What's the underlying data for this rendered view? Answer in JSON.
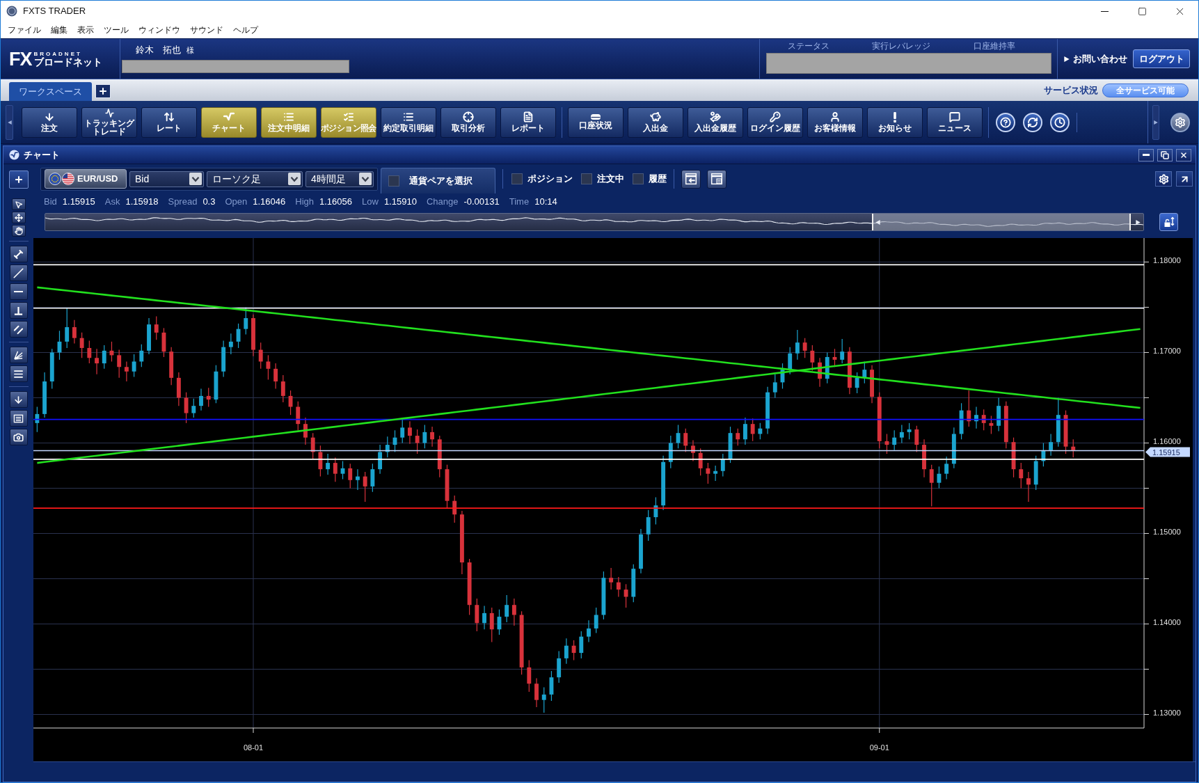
{
  "window": {
    "title": "FXTS TRADER"
  },
  "menu": [
    "ファイル",
    "編集",
    "表示",
    "ツール",
    "ウィンドウ",
    "サウンド",
    "ヘルプ"
  ],
  "header": {
    "logo": {
      "mark": "FX",
      "tagline": "BROADNET",
      "name": "ブロードネット"
    },
    "user": {
      "name": "鈴木　拓也",
      "honorific": "様"
    },
    "account_labels": [
      "ステータス",
      "実行レバレッジ",
      "口座維持率"
    ],
    "inquiry": "お問い合わせ",
    "logout": "ログアウト"
  },
  "tabs": [
    {
      "label": "ワークスペース",
      "selected": true
    }
  ],
  "service": {
    "label": "サービス状況",
    "status": "全サービス可能"
  },
  "toolbar": {
    "groups": [
      [
        {
          "label": "注文",
          "active": false
        },
        {
          "label": "トラッキングトレード",
          "active": false
        },
        {
          "label": "レート",
          "active": false
        },
        {
          "label": "チャート",
          "active": true
        },
        {
          "label": "注文中明細",
          "active": true
        },
        {
          "label": "ポジション照会",
          "active": true
        },
        {
          "label": "約定取引明細",
          "active": false
        },
        {
          "label": "取引分析",
          "active": false
        },
        {
          "label": "レポート",
          "active": false
        }
      ],
      [
        {
          "label": "口座状況",
          "active": false
        },
        {
          "label": "入出金",
          "active": false
        },
        {
          "label": "入出金履歴",
          "active": false
        },
        {
          "label": "ログイン履歴",
          "active": false
        },
        {
          "label": "お客様情報",
          "active": false
        },
        {
          "label": "お知らせ",
          "active": false
        },
        {
          "label": "ニュース",
          "active": false
        }
      ]
    ]
  },
  "chart_window": {
    "title": "チャート",
    "pair": "EUR/USD",
    "selects": [
      {
        "value": "Bid"
      },
      {
        "value": "ローソク足"
      },
      {
        "value": "4時間足"
      }
    ],
    "pair_picker": {
      "label": "通貨ペアを選択",
      "checked": false
    },
    "filters": [
      {
        "label": "ポジション",
        "checked": false
      },
      {
        "label": "注文中",
        "checked": false
      },
      {
        "label": "履歴",
        "checked": false
      }
    ],
    "quote": [
      {
        "label": "Bid",
        "value": "1.15915"
      },
      {
        "label": "Ask",
        "value": "1.15918"
      },
      {
        "label": "Spread",
        "value": "0.3"
      },
      {
        "label": "Open",
        "value": "1.16046"
      },
      {
        "label": "High",
        "value": "1.16056"
      },
      {
        "label": "Low",
        "value": "1.15910"
      },
      {
        "label": "Change",
        "value": "-0.00131"
      },
      {
        "label": "Time",
        "value": "10:14"
      }
    ],
    "chart_data": {
      "type": "candlestick",
      "grid": true,
      "ylim": [
        1.1285,
        1.18265
      ],
      "yticks": [
        {
          "value": 1.13,
          "label": "1.13000"
        },
        {
          "value": 1.14,
          "label": "1.14000"
        },
        {
          "value": 1.15,
          "label": "1.15000"
        },
        {
          "value": 1.16,
          "label": "1.16000"
        },
        {
          "value": 1.17,
          "label": "1.17000"
        },
        {
          "value": 1.18,
          "label": "1.18000"
        }
      ],
      "categories": [
        null,
        null,
        null,
        null,
        null,
        null,
        null,
        null,
        null,
        null,
        null,
        null,
        null,
        null,
        null,
        null,
        null,
        null,
        null,
        null,
        null,
        null,
        null,
        null,
        null,
        null,
        null,
        null,
        null,
        "08-01",
        null,
        null,
        null,
        null,
        null,
        null,
        null,
        null,
        null,
        null,
        null,
        null,
        null,
        null,
        null,
        null,
        null,
        null,
        null,
        null,
        null,
        null,
        null,
        null,
        null,
        null,
        null,
        null,
        null,
        null,
        null,
        null,
        null,
        null,
        null,
        null,
        null,
        null,
        null,
        null,
        null,
        null,
        null,
        null,
        null,
        null,
        null,
        null,
        null,
        null,
        null,
        null,
        null,
        null,
        null,
        null,
        null,
        null,
        null,
        null,
        null,
        null,
        null,
        null,
        null,
        null,
        null,
        null,
        null,
        null,
        null,
        null,
        null,
        null,
        null,
        null,
        null,
        null,
        null,
        null,
        null,
        null,
        null,
        "09-01",
        null,
        null,
        null,
        null,
        null,
        null,
        null,
        null,
        null,
        null,
        null,
        null,
        null,
        null,
        null,
        null,
        null,
        null,
        null,
        null,
        null,
        null,
        null,
        null,
        null,
        null,
        null,
        null,
        null,
        null,
        null,
        null,
        null,
        null,
        null
      ],
      "ohlc": [
        [
          1.1622,
          1.164,
          1.1612,
          1.1632
        ],
        [
          1.1632,
          1.1678,
          1.1628,
          1.1668
        ],
        [
          1.1668,
          1.1704,
          1.166,
          1.17
        ],
        [
          1.17,
          1.1724,
          1.1692,
          1.1712
        ],
        [
          1.1712,
          1.1749,
          1.1705,
          1.1728
        ],
        [
          1.1728,
          1.1736,
          1.171,
          1.1716
        ],
        [
          1.1716,
          1.1722,
          1.1694,
          1.1705
        ],
        [
          1.1705,
          1.1713,
          1.1688,
          1.1694
        ],
        [
          1.1694,
          1.1704,
          1.1676,
          1.1688
        ],
        [
          1.1688,
          1.1708,
          1.1682,
          1.1702
        ],
        [
          1.1702,
          1.1712,
          1.169,
          1.1697
        ],
        [
          1.1697,
          1.1703,
          1.1672,
          1.1684
        ],
        [
          1.1684,
          1.169,
          1.1668,
          1.1679
        ],
        [
          1.1679,
          1.1698,
          1.1673,
          1.169
        ],
        [
          1.169,
          1.1709,
          1.1684,
          1.1702
        ],
        [
          1.1702,
          1.1738,
          1.1698,
          1.1731
        ],
        [
          1.1731,
          1.174,
          1.1714,
          1.1722
        ],
        [
          1.1722,
          1.1727,
          1.1695,
          1.1701
        ],
        [
          1.1701,
          1.1706,
          1.1664,
          1.1672
        ],
        [
          1.1672,
          1.1678,
          1.1641,
          1.165
        ],
        [
          1.165,
          1.1656,
          1.1622,
          1.1633
        ],
        [
          1.1633,
          1.1649,
          1.1628,
          1.1641
        ],
        [
          1.1641,
          1.166,
          1.1636,
          1.1652
        ],
        [
          1.1652,
          1.1661,
          1.164,
          1.1648
        ],
        [
          1.1648,
          1.1686,
          1.1644,
          1.1679
        ],
        [
          1.1679,
          1.1713,
          1.1673,
          1.1706
        ],
        [
          1.1706,
          1.1721,
          1.1698,
          1.1712
        ],
        [
          1.1712,
          1.1732,
          1.1705,
          1.1726
        ],
        [
          1.1726,
          1.175,
          1.172,
          1.1738
        ],
        [
          1.1738,
          1.1742,
          1.1696,
          1.1703
        ],
        [
          1.1703,
          1.1711,
          1.1682,
          1.169
        ],
        [
          1.169,
          1.1697,
          1.167,
          1.1682
        ],
        [
          1.1682,
          1.1688,
          1.166,
          1.1668
        ],
        [
          1.1668,
          1.1675,
          1.1645,
          1.1652
        ],
        [
          1.1652,
          1.1658,
          1.1631,
          1.164
        ],
        [
          1.164,
          1.1646,
          1.1614,
          1.1621
        ],
        [
          1.1621,
          1.1628,
          1.1598,
          1.1606
        ],
        [
          1.1606,
          1.1611,
          1.1582,
          1.159
        ],
        [
          1.159,
          1.1597,
          1.1563,
          1.1571
        ],
        [
          1.1571,
          1.1588,
          1.1565,
          1.1578
        ],
        [
          1.1578,
          1.1584,
          1.1557,
          1.1566
        ],
        [
          1.1566,
          1.158,
          1.156,
          1.1572
        ],
        [
          1.1572,
          1.1577,
          1.155,
          1.1559
        ],
        [
          1.1559,
          1.1571,
          1.1548,
          1.1563
        ],
        [
          1.1563,
          1.1568,
          1.1535,
          1.1552
        ],
        [
          1.1552,
          1.1577,
          1.1546,
          1.1571
        ],
        [
          1.1571,
          1.1598,
          1.1566,
          1.159
        ],
        [
          1.159,
          1.1607,
          1.1584,
          1.1598
        ],
        [
          1.1598,
          1.1614,
          1.159,
          1.1606
        ],
        [
          1.1606,
          1.1626,
          1.16,
          1.1617
        ],
        [
          1.1617,
          1.1624,
          1.1599,
          1.1608
        ],
        [
          1.1608,
          1.1615,
          1.1588,
          1.16
        ],
        [
          1.16,
          1.162,
          1.1594,
          1.1612
        ],
        [
          1.1612,
          1.1618,
          1.1596,
          1.1604
        ],
        [
          1.1604,
          1.1608,
          1.1562,
          1.1571
        ],
        [
          1.1571,
          1.1576,
          1.1528,
          1.1536
        ],
        [
          1.1536,
          1.1542,
          1.1512,
          1.1521
        ],
        [
          1.1521,
          1.1525,
          1.1455,
          1.1468
        ],
        [
          1.1468,
          1.1472,
          1.141,
          1.1421
        ],
        [
          1.1421,
          1.1428,
          1.1392,
          1.1401
        ],
        [
          1.1401,
          1.142,
          1.1394,
          1.1412
        ],
        [
          1.1412,
          1.1418,
          1.138,
          1.1394
        ],
        [
          1.1394,
          1.1416,
          1.1388,
          1.1408
        ],
        [
          1.1408,
          1.1432,
          1.1402,
          1.1421
        ],
        [
          1.1421,
          1.1428,
          1.1398,
          1.141
        ],
        [
          1.141,
          1.1414,
          1.1344,
          1.1352
        ],
        [
          1.1352,
          1.136,
          1.1325,
          1.1334
        ],
        [
          1.1334,
          1.134,
          1.1308,
          1.1316
        ],
        [
          1.1316,
          1.133,
          1.1302,
          1.1322
        ],
        [
          1.1322,
          1.1348,
          1.1315,
          1.1341
        ],
        [
          1.1341,
          1.137,
          1.1335,
          1.1362
        ],
        [
          1.1362,
          1.1384,
          1.1356,
          1.1376
        ],
        [
          1.1376,
          1.1382,
          1.136,
          1.1368
        ],
        [
          1.1368,
          1.1392,
          1.1362,
          1.1386
        ],
        [
          1.1386,
          1.1404,
          1.138,
          1.1395
        ],
        [
          1.1395,
          1.1418,
          1.139,
          1.141
        ],
        [
          1.141,
          1.1458,
          1.1405,
          1.1451
        ],
        [
          1.1451,
          1.1462,
          1.1438,
          1.1446
        ],
        [
          1.1446,
          1.1452,
          1.143,
          1.1438
        ],
        [
          1.1438,
          1.1444,
          1.1418,
          1.143
        ],
        [
          1.143,
          1.1466,
          1.1424,
          1.1461
        ],
        [
          1.1461,
          1.1505,
          1.1456,
          1.1499
        ],
        [
          1.1499,
          1.1526,
          1.1492,
          1.1518
        ],
        [
          1.1518,
          1.154,
          1.151,
          1.1531
        ],
        [
          1.1531,
          1.1586,
          1.1526,
          1.1579
        ],
        [
          1.1579,
          1.1608,
          1.1572,
          1.16
        ],
        [
          1.16,
          1.162,
          1.1594,
          1.1611
        ],
        [
          1.1611,
          1.1616,
          1.159,
          1.1597
        ],
        [
          1.1597,
          1.1603,
          1.158,
          1.1589
        ],
        [
          1.1589,
          1.1594,
          1.1564,
          1.1572
        ],
        [
          1.1572,
          1.1578,
          1.1555,
          1.1566
        ],
        [
          1.1566,
          1.1575,
          1.1558,
          1.1569
        ],
        [
          1.1569,
          1.1588,
          1.1563,
          1.1582
        ],
        [
          1.1582,
          1.1618,
          1.1578,
          1.1611
        ],
        [
          1.1611,
          1.1616,
          1.1597,
          1.1604
        ],
        [
          1.1604,
          1.1628,
          1.1598,
          1.1621
        ],
        [
          1.1621,
          1.1627,
          1.1602,
          1.161
        ],
        [
          1.161,
          1.1622,
          1.1604,
          1.1616
        ],
        [
          1.1616,
          1.1662,
          1.161,
          1.1656
        ],
        [
          1.1656,
          1.1676,
          1.165,
          1.1667
        ],
        [
          1.1667,
          1.1688,
          1.166,
          1.1681
        ],
        [
          1.1681,
          1.1706,
          1.1676,
          1.1699
        ],
        [
          1.1699,
          1.1725,
          1.1692,
          1.1711
        ],
        [
          1.1711,
          1.1716,
          1.1694,
          1.1702
        ],
        [
          1.1702,
          1.1708,
          1.168,
          1.1689
        ],
        [
          1.1689,
          1.1694,
          1.1662,
          1.1671
        ],
        [
          1.1671,
          1.17,
          1.1666,
          1.1695
        ],
        [
          1.1695,
          1.1704,
          1.1684,
          1.1692
        ],
        [
          1.1692,
          1.1715,
          1.1688,
          1.1701
        ],
        [
          1.1701,
          1.1706,
          1.1654,
          1.1661
        ],
        [
          1.1661,
          1.1678,
          1.1655,
          1.1672
        ],
        [
          1.1672,
          1.169,
          1.1666,
          1.1681
        ],
        [
          1.1681,
          1.1686,
          1.1644,
          1.1651
        ],
        [
          1.1651,
          1.1656,
          1.1594,
          1.1602
        ],
        [
          1.1602,
          1.161,
          1.1588,
          1.1598
        ],
        [
          1.1598,
          1.1614,
          1.1592,
          1.1606
        ],
        [
          1.1606,
          1.162,
          1.16,
          1.1612
        ],
        [
          1.1612,
          1.1622,
          1.1604,
          1.1615
        ],
        [
          1.1615,
          1.1619,
          1.159,
          1.1598
        ],
        [
          1.1598,
          1.1604,
          1.1562,
          1.1571
        ],
        [
          1.1571,
          1.1576,
          1.153,
          1.1556
        ],
        [
          1.1556,
          1.1574,
          1.155,
          1.1566
        ],
        [
          1.1566,
          1.1585,
          1.156,
          1.1577
        ],
        [
          1.1577,
          1.1617,
          1.1572,
          1.161
        ],
        [
          1.161,
          1.1644,
          1.1604,
          1.1636
        ],
        [
          1.1636,
          1.1658,
          1.1618,
          1.1624
        ],
        [
          1.1624,
          1.164,
          1.1616,
          1.1631
        ],
        [
          1.1631,
          1.1637,
          1.1614,
          1.1622
        ],
        [
          1.1622,
          1.163,
          1.161,
          1.1619
        ],
        [
          1.1619,
          1.165,
          1.1613,
          1.1641
        ],
        [
          1.1641,
          1.1646,
          1.1594,
          1.1601
        ],
        [
          1.1601,
          1.1606,
          1.1562,
          1.1571
        ],
        [
          1.1571,
          1.1578,
          1.155,
          1.1561
        ],
        [
          1.1561,
          1.1568,
          1.1535,
          1.1554
        ],
        [
          1.1554,
          1.1586,
          1.1548,
          1.158
        ],
        [
          1.158,
          1.16,
          1.1574,
          1.1592
        ],
        [
          1.1592,
          1.161,
          1.1586,
          1.1601
        ],
        [
          1.1601,
          1.165,
          1.1596,
          1.1631
        ],
        [
          1.1631,
          1.1636,
          1.1588,
          1.1596
        ],
        [
          1.1596,
          1.1604,
          1.1584,
          1.1592
        ],
        null,
        null,
        null,
        null,
        null,
        null,
        null,
        null,
        null
      ],
      "series": [
        {
          "type": "line",
          "color": "#22e01e",
          "values": [
            1.1772,
            1.17711,
            1.17702,
            1.17693,
            1.17684,
            1.17675,
            1.17666,
            1.17657,
            1.17648,
            1.17639,
            1.1763,
            1.17621,
            1.17612,
            1.17603,
            1.17594,
            1.17585,
            1.17576,
            1.17567,
            1.17558,
            1.17549,
            1.1754,
            1.17531,
            1.17522,
            1.17513,
            1.17504,
            1.17495,
            1.17486,
            1.17477,
            1.17468,
            1.17459,
            1.1745,
            1.17441,
            1.17432,
            1.17423,
            1.17414,
            1.17405,
            1.17396,
            1.17387,
            1.17378,
            1.17369,
            1.1736,
            1.17351,
            1.17342,
            1.17333,
            1.17324,
            1.17315,
            1.17306,
            1.17297,
            1.17288,
            1.17279,
            1.1727,
            1.17261,
            1.17252,
            1.17243,
            1.17234,
            1.17225,
            1.17216,
            1.17207,
            1.17198,
            1.17189,
            1.1718,
            1.17171,
            1.17162,
            1.17153,
            1.17144,
            1.17135,
            1.17126,
            1.17117,
            1.17108,
            1.17099,
            1.1709,
            1.17081,
            1.17072,
            1.17063,
            1.17054,
            1.17045,
            1.17036,
            1.17027,
            1.17018,
            1.17009,
            1.17,
            1.16991,
            1.16982,
            1.16973,
            1.16964,
            1.16955,
            1.16946,
            1.16937,
            1.16928,
            1.16919,
            1.1691,
            1.16901,
            1.16892,
            1.16883,
            1.16874,
            1.16865,
            1.16856,
            1.16847,
            1.16838,
            1.16829,
            1.1682,
            1.16811,
            1.16802,
            1.16793,
            1.16784,
            1.16775,
            1.16766,
            1.16757,
            1.16748,
            1.16739,
            1.1673,
            1.16721,
            1.16712,
            1.16703,
            1.16694,
            1.16685,
            1.16676,
            1.16667,
            1.16658,
            1.16649,
            1.1664,
            1.16631,
            1.16622,
            1.16613,
            1.16604,
            1.16595,
            1.16586,
            1.16577,
            1.16568,
            1.16559,
            1.1655,
            1.16541,
            1.16532,
            1.16523,
            1.16514,
            1.16505,
            1.16496,
            1.16487,
            1.16478,
            1.16469,
            1.1646,
            1.16451,
            1.16442,
            1.16433,
            1.16424,
            1.16415,
            1.16406,
            1.16397,
            1.16388
          ]
        },
        {
          "type": "line",
          "color": "#22e01e",
          "values": [
            1.1578,
            1.1579,
            1.158,
            1.1581,
            1.1582,
            1.1583,
            1.1584,
            1.1585,
            1.1586,
            1.1587,
            1.1588,
            1.1589,
            1.159,
            1.1591,
            1.1592,
            1.1593,
            1.1594,
            1.1595,
            1.1596,
            1.1597,
            1.1598,
            1.1599,
            1.16,
            1.1601,
            1.1602,
            1.1603,
            1.1604,
            1.1605,
            1.1606,
            1.1607,
            1.1608,
            1.1609,
            1.161,
            1.1611,
            1.1612,
            1.1613,
            1.1614,
            1.1615,
            1.1616,
            1.1617,
            1.1618,
            1.1619,
            1.162,
            1.1621,
            1.1622,
            1.1623,
            1.1624,
            1.1625,
            1.1626,
            1.1627,
            1.1628,
            1.1629,
            1.163,
            1.1631,
            1.1632,
            1.1633,
            1.1634,
            1.1635,
            1.1636,
            1.1637,
            1.1638,
            1.1639,
            1.164,
            1.1641,
            1.1642,
            1.1643,
            1.1644,
            1.1645,
            1.1646,
            1.1647,
            1.1648,
            1.1649,
            1.165,
            1.1651,
            1.1652,
            1.1653,
            1.1654,
            1.1655,
            1.1656,
            1.1657,
            1.1658,
            1.1659,
            1.166,
            1.1661,
            1.1662,
            1.1663,
            1.1664,
            1.1665,
            1.1666,
            1.1667,
            1.1668,
            1.1669,
            1.167,
            1.1671,
            1.1672,
            1.1673,
            1.1674,
            1.1675,
            1.1676,
            1.1677,
            1.1678,
            1.1679,
            1.168,
            1.1681,
            1.1682,
            1.1683,
            1.1684,
            1.1685,
            1.1686,
            1.1687,
            1.1688,
            1.1689,
            1.169,
            1.1691,
            1.1692,
            1.1693,
            1.1694,
            1.1695,
            1.1696,
            1.1697,
            1.1698,
            1.1699,
            1.17,
            1.1701,
            1.1702,
            1.1703,
            1.1704,
            1.1705,
            1.1706,
            1.1707,
            1.1708,
            1.1709,
            1.171,
            1.1711,
            1.1712,
            1.1713,
            1.1714,
            1.1715,
            1.1716,
            1.1717,
            1.1718,
            1.1719,
            1.172,
            1.1721,
            1.1722,
            1.1723,
            1.1724,
            1.1725,
            1.1726
          ]
        }
      ],
      "ref_lines": [
        {
          "axis": "y",
          "value": 1.1797,
          "color": "#ffffff"
        },
        {
          "axis": "y",
          "value": 1.1749,
          "color": "#ffffff"
        },
        {
          "axis": "y",
          "value": 1.1626,
          "color": "#1010ff"
        },
        {
          "axis": "y",
          "value": 1.15915,
          "label": "1.15915",
          "color": "#c4d8ff"
        },
        {
          "axis": "y",
          "value": 1.1582,
          "color": "#ffffff"
        },
        {
          "axis": "y",
          "value": 1.1528,
          "color": "#ff1a1a"
        }
      ]
    }
  }
}
